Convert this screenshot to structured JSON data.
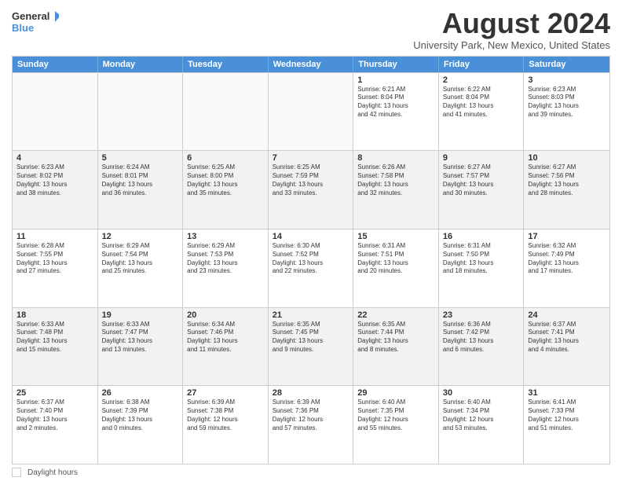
{
  "logo": {
    "line1": "General",
    "line2": "Blue"
  },
  "title": "August 2024",
  "subtitle": "University Park, New Mexico, United States",
  "weekdays": [
    "Sunday",
    "Monday",
    "Tuesday",
    "Wednesday",
    "Thursday",
    "Friday",
    "Saturday"
  ],
  "rows": [
    [
      {
        "day": "",
        "info": ""
      },
      {
        "day": "",
        "info": ""
      },
      {
        "day": "",
        "info": ""
      },
      {
        "day": "",
        "info": ""
      },
      {
        "day": "1",
        "info": "Sunrise: 6:21 AM\nSunset: 8:04 PM\nDaylight: 13 hours\nand 42 minutes."
      },
      {
        "day": "2",
        "info": "Sunrise: 6:22 AM\nSunset: 8:04 PM\nDaylight: 13 hours\nand 41 minutes."
      },
      {
        "day": "3",
        "info": "Sunrise: 6:23 AM\nSunset: 8:03 PM\nDaylight: 13 hours\nand 39 minutes."
      }
    ],
    [
      {
        "day": "4",
        "info": "Sunrise: 6:23 AM\nSunset: 8:02 PM\nDaylight: 13 hours\nand 38 minutes."
      },
      {
        "day": "5",
        "info": "Sunrise: 6:24 AM\nSunset: 8:01 PM\nDaylight: 13 hours\nand 36 minutes."
      },
      {
        "day": "6",
        "info": "Sunrise: 6:25 AM\nSunset: 8:00 PM\nDaylight: 13 hours\nand 35 minutes."
      },
      {
        "day": "7",
        "info": "Sunrise: 6:25 AM\nSunset: 7:59 PM\nDaylight: 13 hours\nand 33 minutes."
      },
      {
        "day": "8",
        "info": "Sunrise: 6:26 AM\nSunset: 7:58 PM\nDaylight: 13 hours\nand 32 minutes."
      },
      {
        "day": "9",
        "info": "Sunrise: 6:27 AM\nSunset: 7:57 PM\nDaylight: 13 hours\nand 30 minutes."
      },
      {
        "day": "10",
        "info": "Sunrise: 6:27 AM\nSunset: 7:56 PM\nDaylight: 13 hours\nand 28 minutes."
      }
    ],
    [
      {
        "day": "11",
        "info": "Sunrise: 6:28 AM\nSunset: 7:55 PM\nDaylight: 13 hours\nand 27 minutes."
      },
      {
        "day": "12",
        "info": "Sunrise: 6:29 AM\nSunset: 7:54 PM\nDaylight: 13 hours\nand 25 minutes."
      },
      {
        "day": "13",
        "info": "Sunrise: 6:29 AM\nSunset: 7:53 PM\nDaylight: 13 hours\nand 23 minutes."
      },
      {
        "day": "14",
        "info": "Sunrise: 6:30 AM\nSunset: 7:52 PM\nDaylight: 13 hours\nand 22 minutes."
      },
      {
        "day": "15",
        "info": "Sunrise: 6:31 AM\nSunset: 7:51 PM\nDaylight: 13 hours\nand 20 minutes."
      },
      {
        "day": "16",
        "info": "Sunrise: 6:31 AM\nSunset: 7:50 PM\nDaylight: 13 hours\nand 18 minutes."
      },
      {
        "day": "17",
        "info": "Sunrise: 6:32 AM\nSunset: 7:49 PM\nDaylight: 13 hours\nand 17 minutes."
      }
    ],
    [
      {
        "day": "18",
        "info": "Sunrise: 6:33 AM\nSunset: 7:48 PM\nDaylight: 13 hours\nand 15 minutes."
      },
      {
        "day": "19",
        "info": "Sunrise: 6:33 AM\nSunset: 7:47 PM\nDaylight: 13 hours\nand 13 minutes."
      },
      {
        "day": "20",
        "info": "Sunrise: 6:34 AM\nSunset: 7:46 PM\nDaylight: 13 hours\nand 11 minutes."
      },
      {
        "day": "21",
        "info": "Sunrise: 6:35 AM\nSunset: 7:45 PM\nDaylight: 13 hours\nand 9 minutes."
      },
      {
        "day": "22",
        "info": "Sunrise: 6:35 AM\nSunset: 7:44 PM\nDaylight: 13 hours\nand 8 minutes."
      },
      {
        "day": "23",
        "info": "Sunrise: 6:36 AM\nSunset: 7:42 PM\nDaylight: 13 hours\nand 6 minutes."
      },
      {
        "day": "24",
        "info": "Sunrise: 6:37 AM\nSunset: 7:41 PM\nDaylight: 13 hours\nand 4 minutes."
      }
    ],
    [
      {
        "day": "25",
        "info": "Sunrise: 6:37 AM\nSunset: 7:40 PM\nDaylight: 13 hours\nand 2 minutes."
      },
      {
        "day": "26",
        "info": "Sunrise: 6:38 AM\nSunset: 7:39 PM\nDaylight: 13 hours\nand 0 minutes."
      },
      {
        "day": "27",
        "info": "Sunrise: 6:39 AM\nSunset: 7:38 PM\nDaylight: 12 hours\nand 59 minutes."
      },
      {
        "day": "28",
        "info": "Sunrise: 6:39 AM\nSunset: 7:36 PM\nDaylight: 12 hours\nand 57 minutes."
      },
      {
        "day": "29",
        "info": "Sunrise: 6:40 AM\nSunset: 7:35 PM\nDaylight: 12 hours\nand 55 minutes."
      },
      {
        "day": "30",
        "info": "Sunrise: 6:40 AM\nSunset: 7:34 PM\nDaylight: 12 hours\nand 53 minutes."
      },
      {
        "day": "31",
        "info": "Sunrise: 6:41 AM\nSunset: 7:33 PM\nDaylight: 12 hours\nand 51 minutes."
      }
    ]
  ],
  "footer": {
    "daylight_label": "Daylight hours"
  }
}
